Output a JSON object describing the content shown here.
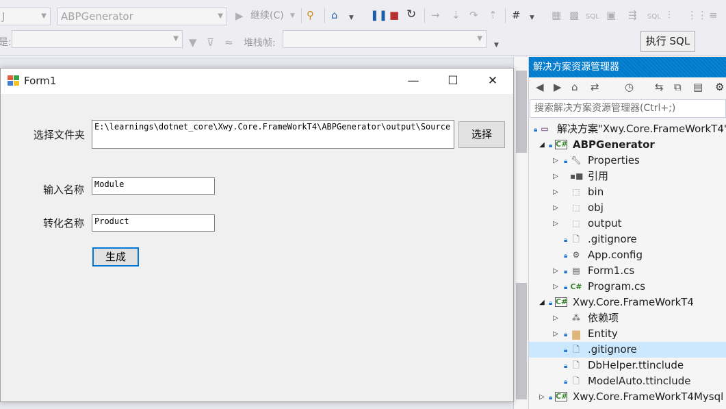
{
  "toolbar": {
    "project_combo": "ABPGenerator",
    "continue_label": "继续(C)",
    "sql_icon_label": "SQL",
    "sql_icon_label2": "SQL",
    "stack_frame_label": "堆栈帧:",
    "left_label": "是:",
    "exec_sql": "执行 SQL"
  },
  "solution_explorer": {
    "title": "解决方案资源管理器",
    "search_placeholder": "搜索解决方案资源管理器(Ctrl+;)",
    "items": [
      {
        "label": "解决方案\"Xwy.Core.FrameWorkT4\"",
        "icon": "solution-icon"
      },
      {
        "label": "ABPGenerator",
        "icon": "csharp-project-icon"
      },
      {
        "label": "Properties",
        "icon": "wrench-icon"
      },
      {
        "label": "引用",
        "icon": "references-icon"
      },
      {
        "label": "bin",
        "icon": "folder-dotted-icon"
      },
      {
        "label": "obj",
        "icon": "folder-dotted-icon"
      },
      {
        "label": "output",
        "icon": "folder-dotted-icon"
      },
      {
        "label": ".gitignore",
        "icon": "file-icon"
      },
      {
        "label": "App.config",
        "icon": "config-file-icon"
      },
      {
        "label": "Form1.cs",
        "icon": "form-icon"
      },
      {
        "label": "Program.cs",
        "icon": "csharp-file-icon"
      },
      {
        "label": "Xwy.Core.FrameWorkT4",
        "icon": "csharp-project-icon"
      },
      {
        "label": "依赖项",
        "icon": "dependencies-icon"
      },
      {
        "label": "Entity",
        "icon": "folder-icon"
      },
      {
        "label": ".gitignore",
        "icon": "file-icon"
      },
      {
        "label": "DbHelper.ttinclude",
        "icon": "file-icon"
      },
      {
        "label": "ModelAuto.ttinclude",
        "icon": "file-icon"
      },
      {
        "label": "Xwy.Core.FrameWorkT4Mysql",
        "icon": "csharp-project-icon"
      }
    ]
  },
  "form1": {
    "title": "Form1",
    "folder_label": "选择文件夹",
    "folder_value": "E:\\learnings\\dotnet_core\\Xwy.Core.FrameWorkT4\\ABPGenerator\\output\\Source",
    "select_button": "选择",
    "input_name_label": "输入名称",
    "input_name_value": "Module",
    "convert_name_label": "转化名称",
    "convert_name_value": "Product",
    "generate_button": "生成"
  },
  "colors": {
    "accent": "#007acc",
    "selected_row": "#cce8ff",
    "focus_border": "#0078d7"
  }
}
